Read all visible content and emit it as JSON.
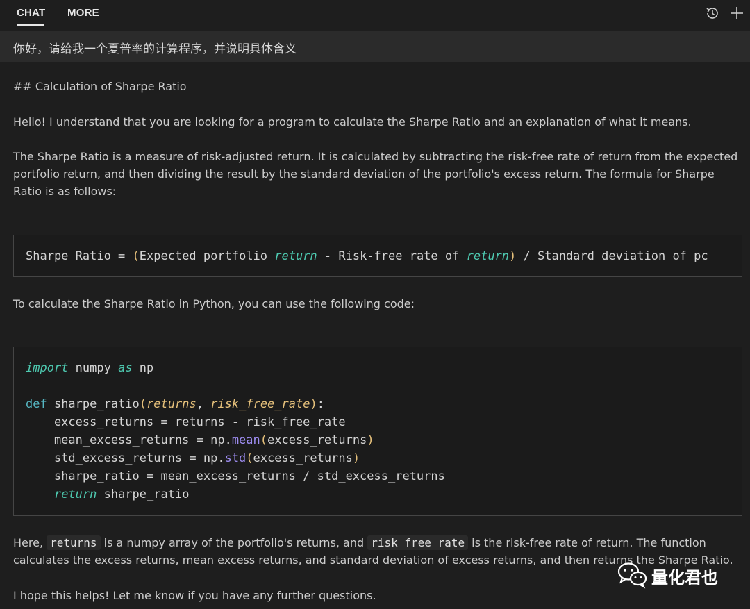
{
  "tabs": [
    {
      "label": "CHAT",
      "active": true
    },
    {
      "label": "MORE",
      "active": false
    }
  ],
  "toolbar": {
    "history_icon": "history-icon",
    "new_icon": "plus-icon"
  },
  "prompt": "你好，请给我一个夏普率的计算程序，并说明具体含义",
  "response": {
    "heading": "## Calculation of Sharpe Ratio",
    "intro": "Hello! I understand that you are looking for a program to calculate the Sharpe Ratio and an explanation of what it means.",
    "definition": "The Sharpe Ratio is a measure of risk-adjusted return. It is calculated by subtracting the risk-free rate of return from the expected portfolio return, and then dividing the result by the standard deviation of the portfolio's excess return. The formula for Sharpe Ratio is as follows:",
    "formula": {
      "prefix": "Sharpe Ratio = ",
      "open": "(",
      "part1": "Expected portfolio ",
      "kw1": "return",
      "part2": " - Risk-free rate of ",
      "kw2": "return",
      "close": ")",
      "suffix": " / Standard deviation of pc"
    },
    "code_intro": "To calculate the Sharpe Ratio in Python, you can use the following code:",
    "code": {
      "l1_kw": "import",
      "l1_a": " numpy ",
      "l1_kw2": "as",
      "l1_b": " np",
      "l3_def": "def",
      "l3_fn": " sharpe_ratio",
      "l3_open": "(",
      "l3_p1": "returns",
      "l3_comma": ", ",
      "l3_p2": "risk_free_rate",
      "l3_close": ")",
      "l3_colon": ":",
      "l4": "    excess_returns = returns - risk_free_rate",
      "l5_a": "    mean_excess_returns = np.",
      "l5_fn": "mean",
      "l5_open": "(",
      "l5_arg": "excess_returns",
      "l5_close": ")",
      "l6_a": "    std_excess_returns = np.",
      "l6_fn": "std",
      "l6_open": "(",
      "l6_arg": "excess_returns",
      "l6_close": ")",
      "l7": "    sharpe_ratio = mean_excess_returns / std_excess_returns",
      "l8_indent": "    ",
      "l8_kw": "return",
      "l8_b": " sharpe_ratio"
    },
    "explain": {
      "a": "Here, ",
      "code1": "returns",
      "b": " is a numpy array of the portfolio's returns, and ",
      "code2": "risk_free_rate",
      "c": " is the risk-free rate of return. The function calculates the excess returns, mean excess returns, and standard deviation of excess returns, and then returns the Sharpe Ratio."
    },
    "closing": "I hope this helps! Let me know if you have any further questions."
  },
  "watermark": {
    "text": "量化君也",
    "icon": "wechat-icon"
  }
}
